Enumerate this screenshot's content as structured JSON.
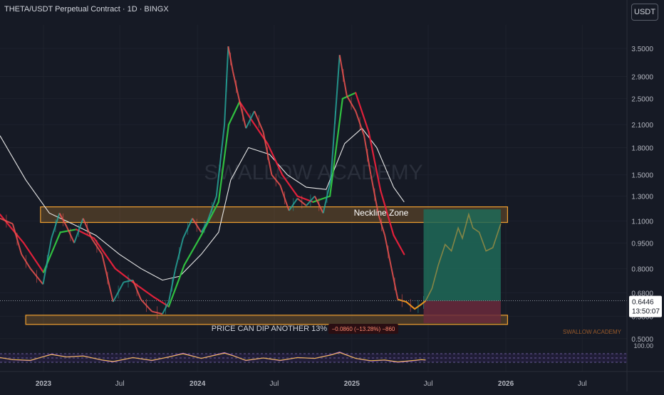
{
  "header": {
    "symbol_title": "THETA/USDT Perpetual Contract · 1D · BINGX",
    "currency_button": "USDT"
  },
  "colors": {
    "background": "#161a25",
    "zone_border": "#f0a030",
    "zone_fill": "#f0a030",
    "ema_fast_down": "#e0203a",
    "ema_fast_up": "#30c040",
    "ema_slow": "#e8e8e8",
    "candle_up": "#26a69a",
    "candle_down": "#ef5350",
    "projection_fill": "#1e6a58",
    "risk_fill": "#6a2a3c",
    "rsi_line": "#b060e0",
    "rsi_signal": "#f0c040"
  },
  "annotations": {
    "watermark": "SWALLOW ACADEMY",
    "neckline_label": "Neckline Zone",
    "dip_text": "PRICE CAN DIP ANOTHER 13%",
    "measure_label": "−0.0860 (−13.28%) −860",
    "brand_small": "SWALLOW ACADEMY"
  },
  "price_tag": {
    "price": "0.6446",
    "countdown": "13:50:07"
  },
  "chart_data": {
    "type": "line",
    "title": "THETA/USDT Perpetual Contract · 1D · BINGX",
    "y_scale": "log",
    "ylim": [
      0.49,
      4.1
    ],
    "y_ticks": [
      "3.5000",
      "2.9000",
      "2.5000",
      "2.1000",
      "1.8000",
      "1.5000",
      "1.3000",
      "1.1000",
      "0.9500",
      "0.8000",
      "0.6800",
      "0.5800",
      "0.5000"
    ],
    "x_ticks": [
      "2023",
      "Jul",
      "2024",
      "Jul",
      "2025",
      "Jul",
      "2026",
      "Jul"
    ],
    "xlim": [
      "2022-09-20",
      "2026-10-15"
    ],
    "price_series": {
      "name": "THETA/USDT",
      "points": [
        [
          "2022-09-20",
          1.12
        ],
        [
          "2022-10-20",
          1.08
        ],
        [
          "2022-11-10",
          0.88
        ],
        [
          "2022-12-01",
          0.8
        ],
        [
          "2022-12-31",
          0.72
        ],
        [
          "2023-01-20",
          0.98
        ],
        [
          "2023-02-08",
          1.16
        ],
        [
          "2023-02-25",
          1.06
        ],
        [
          "2023-03-15",
          0.95
        ],
        [
          "2023-04-05",
          1.12
        ],
        [
          "2023-04-25",
          0.98
        ],
        [
          "2023-05-20",
          0.88
        ],
        [
          "2023-06-15",
          0.64
        ],
        [
          "2023-07-10",
          0.73
        ],
        [
          "2023-08-01",
          0.74
        ],
        [
          "2023-08-20",
          0.65
        ],
        [
          "2023-09-15",
          0.6
        ],
        [
          "2023-10-10",
          0.59
        ],
        [
          "2023-10-25",
          0.64
        ],
        [
          "2023-11-10",
          0.8
        ],
        [
          "2023-11-28",
          0.98
        ],
        [
          "2023-12-20",
          1.12
        ],
        [
          "2024-01-10",
          1.02
        ],
        [
          "2024-01-25",
          1.1
        ],
        [
          "2024-02-15",
          1.3
        ],
        [
          "2024-03-05",
          2.1
        ],
        [
          "2024-03-14",
          3.55
        ],
        [
          "2024-03-25",
          3.0
        ],
        [
          "2024-04-10",
          2.45
        ],
        [
          "2024-04-25",
          2.05
        ],
        [
          "2024-05-15",
          2.3
        ],
        [
          "2024-06-05",
          2.0
        ],
        [
          "2024-06-25",
          1.5
        ],
        [
          "2024-07-15",
          1.4
        ],
        [
          "2024-08-05",
          1.18
        ],
        [
          "2024-08-25",
          1.28
        ],
        [
          "2024-09-15",
          1.22
        ],
        [
          "2024-10-05",
          1.3
        ],
        [
          "2024-10-25",
          1.16
        ],
        [
          "2024-11-12",
          1.45
        ],
        [
          "2024-12-03",
          3.35
        ],
        [
          "2024-12-20",
          2.55
        ],
        [
          "2025-01-10",
          2.3
        ],
        [
          "2025-01-30",
          1.95
        ],
        [
          "2025-02-15",
          1.5
        ],
        [
          "2025-03-05",
          1.15
        ],
        [
          "2025-03-20",
          1.0
        ],
        [
          "2025-04-05",
          0.8
        ],
        [
          "2025-04-20",
          0.65
        ],
        [
          "2025-05-10",
          0.64
        ],
        [
          "2025-05-30",
          0.61
        ],
        [
          "2025-06-15",
          0.63
        ],
        [
          "2025-06-25",
          0.6446
        ]
      ]
    },
    "projection_series": {
      "name": "projection",
      "points": [
        [
          "2025-06-25",
          0.6446
        ],
        [
          "2025-07-10",
          0.7
        ],
        [
          "2025-07-25",
          0.82
        ],
        [
          "2025-08-10",
          0.94
        ],
        [
          "2025-08-25",
          0.9
        ],
        [
          "2025-09-10",
          1.05
        ],
        [
          "2025-09-20",
          0.98
        ],
        [
          "2025-10-05",
          1.15
        ],
        [
          "2025-10-15",
          1.05
        ],
        [
          "2025-10-30",
          1.02
        ],
        [
          "2025-11-15",
          0.9
        ],
        [
          "2025-12-01",
          0.92
        ],
        [
          "2025-12-20",
          1.08
        ]
      ]
    },
    "ema_fast": {
      "name": "EMA fast",
      "points": [
        [
          "2022-09-20",
          1.15
        ],
        [
          "2022-11-15",
          0.95
        ],
        [
          "2023-01-01",
          0.78
        ],
        [
          "2023-02-10",
          1.02
        ],
        [
          "2023-03-20",
          1.04
        ],
        [
          "2023-05-01",
          0.98
        ],
        [
          "2023-06-20",
          0.8
        ],
        [
          "2023-08-01",
          0.73
        ],
        [
          "2023-09-20",
          0.66
        ],
        [
          "2023-10-25",
          0.62
        ],
        [
          "2023-12-01",
          0.82
        ],
        [
          "2024-01-10",
          1.0
        ],
        [
          "2024-02-20",
          1.25
        ],
        [
          "2024-03-15",
          2.1
        ],
        [
          "2024-04-10",
          2.45
        ],
        [
          "2024-05-10",
          2.15
        ],
        [
          "2024-06-15",
          1.85
        ],
        [
          "2024-07-20",
          1.5
        ],
        [
          "2024-08-25",
          1.3
        ],
        [
          "2024-10-01",
          1.25
        ],
        [
          "2024-11-10",
          1.3
        ],
        [
          "2024-12-10",
          2.5
        ],
        [
          "2025-01-10",
          2.6
        ],
        [
          "2025-02-10",
          2.0
        ],
        [
          "2025-03-10",
          1.35
        ],
        [
          "2025-04-10",
          1.0
        ],
        [
          "2025-05-05",
          0.88
        ]
      ]
    },
    "ema_slow": {
      "name": "EMA slow",
      "points": [
        [
          "2022-09-20",
          1.95
        ],
        [
          "2022-11-20",
          1.45
        ],
        [
          "2023-01-15",
          1.16
        ],
        [
          "2023-03-10",
          1.08
        ],
        [
          "2023-05-05",
          1.0
        ],
        [
          "2023-06-30",
          0.88
        ],
        [
          "2023-08-20",
          0.8
        ],
        [
          "2023-10-10",
          0.74
        ],
        [
          "2023-11-20",
          0.76
        ],
        [
          "2024-01-10",
          0.88
        ],
        [
          "2024-02-20",
          1.02
        ],
        [
          "2024-03-20",
          1.45
        ],
        [
          "2024-05-01",
          1.8
        ],
        [
          "2024-06-20",
          1.72
        ],
        [
          "2024-08-01",
          1.5
        ],
        [
          "2024-09-15",
          1.38
        ],
        [
          "2024-11-01",
          1.36
        ],
        [
          "2024-12-15",
          1.85
        ],
        [
          "2025-01-25",
          2.05
        ],
        [
          "2025-03-01",
          1.8
        ],
        [
          "2025-04-10",
          1.38
        ],
        [
          "2025-05-05",
          1.25
        ]
      ]
    },
    "zones": [
      {
        "label": "Neckline Zone",
        "y_range": [
          1.09,
          1.21
        ],
        "x_range": [
          "2022-12-25",
          "2026-01-05"
        ]
      },
      {
        "label": "",
        "y_range": [
          0.55,
          0.585
        ],
        "x_range": [
          "2022-11-20",
          "2026-01-05"
        ]
      }
    ],
    "measure_box": {
      "x_range": [
        "2025-06-20",
        "2025-12-20"
      ],
      "reward_y": [
        0.6446,
        1.19
      ],
      "risk_y": [
        0.555,
        0.6446
      ]
    },
    "rsi": {
      "label": "100.00",
      "levels": [
        70,
        50,
        30
      ],
      "points": [
        [
          "2022-09-20",
          52
        ],
        [
          "2022-10-20",
          42
        ],
        [
          "2022-12-01",
          38
        ],
        [
          "2023-01-20",
          68
        ],
        [
          "2023-02-25",
          55
        ],
        [
          "2023-04-05",
          60
        ],
        [
          "2023-05-20",
          40
        ],
        [
          "2023-06-15",
          32
        ],
        [
          "2023-08-01",
          52
        ],
        [
          "2023-09-15",
          38
        ],
        [
          "2023-10-25",
          55
        ],
        [
          "2023-11-28",
          72
        ],
        [
          "2024-01-10",
          48
        ],
        [
          "2024-03-05",
          75
        ],
        [
          "2024-03-25",
          62
        ],
        [
          "2024-04-25",
          38
        ],
        [
          "2024-06-05",
          50
        ],
        [
          "2024-07-15",
          38
        ],
        [
          "2024-08-25",
          52
        ],
        [
          "2024-10-05",
          48
        ],
        [
          "2024-11-12",
          65
        ],
        [
          "2024-12-03",
          78
        ],
        [
          "2025-01-10",
          48
        ],
        [
          "2025-02-15",
          36
        ],
        [
          "2025-03-20",
          40
        ],
        [
          "2025-04-20",
          30
        ],
        [
          "2025-05-30",
          38
        ],
        [
          "2025-06-15",
          42
        ],
        [
          "2025-06-25",
          40
        ]
      ]
    }
  }
}
